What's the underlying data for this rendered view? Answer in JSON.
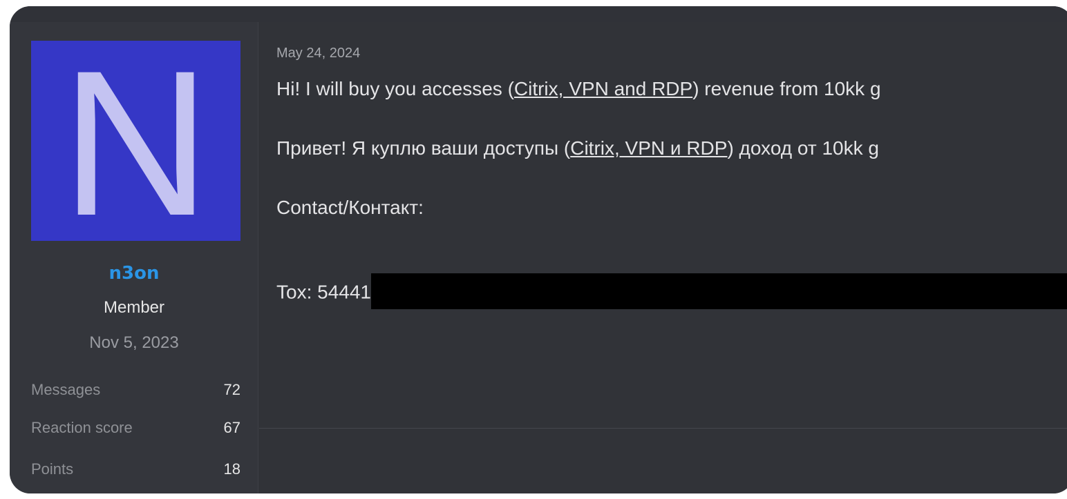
{
  "user": {
    "avatar_letter": "N",
    "username": "n3on",
    "title": "Member",
    "join_date": "Nov 5, 2023",
    "stats": [
      {
        "label": "Messages",
        "value": "72"
      },
      {
        "label": "Reaction score",
        "value": "67"
      },
      {
        "label": "Points",
        "value": "18"
      }
    ]
  },
  "post": {
    "date": "May 24, 2024",
    "line_en": {
      "prefix": "Hi! I will buy you accesses (",
      "link": "Citrix, VPN and RDP",
      "suffix": ") revenue from 10kk ",
      "tail_link": "g"
    },
    "line_ru": {
      "prefix": "Привет! Я куплю ваши доступы (",
      "link": "Citrix, VPN и RDP",
      "suffix": ") доход от 10kk ",
      "tail_link": "g"
    },
    "contact_label": "Contact/Контакт:",
    "tox_label": "Tox: 54441"
  },
  "colors": {
    "avatar_bg": "#3537c6",
    "avatar_letter": "#c4c3f2",
    "username": "#2a95e6",
    "background": "#313338",
    "sidebar_bg": "#34363c",
    "redaction": "#000000"
  }
}
